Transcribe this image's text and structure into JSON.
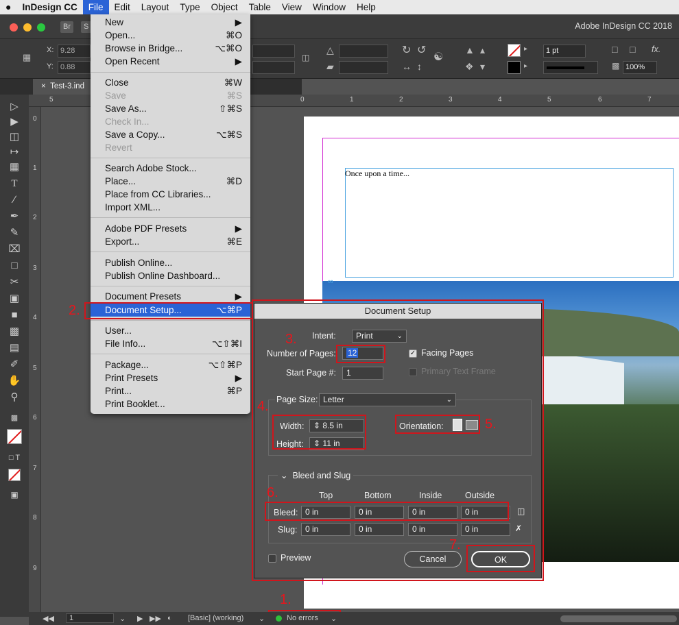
{
  "menubar": {
    "apple": "",
    "items": [
      "InDesign CC",
      "File",
      "Edit",
      "Layout",
      "Type",
      "Object",
      "Table",
      "View",
      "Window",
      "Help"
    ]
  },
  "titlebar": {
    "bridge_tag": "Br",
    "stock_tag": "S",
    "app_title": "Adobe InDesign CC 2018"
  },
  "control": {
    "x_label": "X:",
    "x_value": "9.28",
    "y_label": "Y:",
    "y_value": "0.88",
    "stroke_weight": "1 pt",
    "zoom": "100%",
    "fx": "fx."
  },
  "doc_tab": {
    "close": "×",
    "name": "Test-3.ind"
  },
  "ruler": {
    "top": [
      "5",
      "0",
      "1",
      "2",
      "3",
      "4",
      "5",
      "6",
      "7"
    ],
    "left": [
      "0",
      "1",
      "2",
      "3",
      "4",
      "5",
      "6",
      "7",
      "8",
      "9"
    ]
  },
  "story_text": "Once upon a time...",
  "file_menu": {
    "groups": [
      [
        {
          "label": "New",
          "shortcut": "▶",
          "disabled": false
        },
        {
          "label": "Open...",
          "shortcut": "⌘O",
          "disabled": false
        },
        {
          "label": "Browse in Bridge...",
          "shortcut": "⌥⌘O",
          "disabled": false
        },
        {
          "label": "Open Recent",
          "shortcut": "▶",
          "disabled": false
        }
      ],
      [
        {
          "label": "Close",
          "shortcut": "⌘W",
          "disabled": false
        },
        {
          "label": "Save",
          "shortcut": "⌘S",
          "disabled": true
        },
        {
          "label": "Save As...",
          "shortcut": "⇧⌘S",
          "disabled": false
        },
        {
          "label": "Check In...",
          "shortcut": "",
          "disabled": true
        },
        {
          "label": "Save a Copy...",
          "shortcut": "⌥⌘S",
          "disabled": false
        },
        {
          "label": "Revert",
          "shortcut": "",
          "disabled": true
        }
      ],
      [
        {
          "label": "Search Adobe Stock...",
          "shortcut": "",
          "disabled": false
        },
        {
          "label": "Place...",
          "shortcut": "⌘D",
          "disabled": false
        },
        {
          "label": "Place from CC Libraries...",
          "shortcut": "",
          "disabled": false
        },
        {
          "label": "Import XML...",
          "shortcut": "",
          "disabled": false
        }
      ],
      [
        {
          "label": "Adobe PDF Presets",
          "shortcut": "▶",
          "disabled": false
        },
        {
          "label": "Export...",
          "shortcut": "⌘E",
          "disabled": false
        }
      ],
      [
        {
          "label": "Publish Online...",
          "shortcut": "",
          "disabled": false
        },
        {
          "label": "Publish Online Dashboard...",
          "shortcut": "",
          "disabled": false
        }
      ],
      [
        {
          "label": "Document Presets",
          "shortcut": "▶",
          "disabled": false
        },
        {
          "label": "Document Setup...",
          "shortcut": "⌥⌘P",
          "disabled": false,
          "highlighted": true
        }
      ],
      [
        {
          "label": "User...",
          "shortcut": "",
          "disabled": false
        },
        {
          "label": "File Info...",
          "shortcut": "⌥⇧⌘I",
          "disabled": false
        }
      ],
      [
        {
          "label": "Package...",
          "shortcut": "⌥⇧⌘P",
          "disabled": false
        },
        {
          "label": "Print Presets",
          "shortcut": "▶",
          "disabled": false
        },
        {
          "label": "Print...",
          "shortcut": "⌘P",
          "disabled": false
        },
        {
          "label": "Print Booklet...",
          "shortcut": "",
          "disabled": false
        }
      ]
    ]
  },
  "dialog": {
    "title": "Document Setup",
    "intent_label": "Intent:",
    "intent_value": "Print",
    "num_pages_label": "Number of Pages:",
    "num_pages_value": "12",
    "start_page_label": "Start Page #:",
    "start_page_value": "1",
    "facing_pages_label": "Facing Pages",
    "primary_text_frame_label": "Primary Text Frame",
    "page_size_label": "Page Size:",
    "page_size_value": "Letter",
    "width_label": "Width:",
    "width_value": "8.5 in",
    "height_label": "Height:",
    "height_value": "11 in",
    "orientation_label": "Orientation:",
    "bleed_slug_label": "Bleed and Slug",
    "col_top": "Top",
    "col_bottom": "Bottom",
    "col_inside": "Inside",
    "col_outside": "Outside",
    "bleed_label": "Bleed:",
    "slug_label": "Slug:",
    "bleed": [
      "0 in",
      "0 in",
      "0 in",
      "0 in"
    ],
    "slug": [
      "0 in",
      "0 in",
      "0 in",
      "0 in"
    ],
    "preview_label": "Preview",
    "cancel_label": "Cancel",
    "ok_label": "OK"
  },
  "annotations": [
    "1.",
    "2.",
    "3.",
    "4.",
    "5.",
    "6.",
    "7."
  ],
  "statusbar": {
    "page": "1",
    "style": "[Basic] (working)",
    "errors": "No errors"
  },
  "colors": {
    "highlight": "#2a63d6",
    "annotation_red": "#d0151c",
    "status_ok": "#2fbf3a"
  }
}
